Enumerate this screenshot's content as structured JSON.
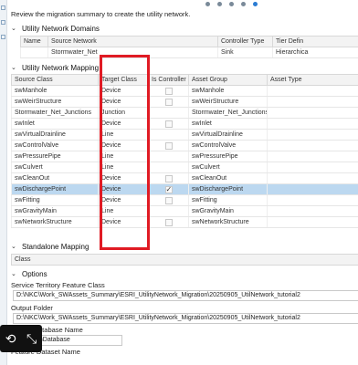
{
  "instruction": "Review the migration summary to create the utility network.",
  "domains": {
    "title": "Utility Network Domains",
    "columns": [
      "Name",
      "Source Network",
      "Controller Type",
      "Tier Defin"
    ],
    "rows": [
      [
        "",
        "Stormwater_Net",
        "Sink",
        "Hierarchica"
      ]
    ]
  },
  "mapping": {
    "title": "Utility Network Mapping",
    "columns": [
      "Source Class",
      "Target Class",
      "Is Controller",
      "Asset Group",
      "Asset Type"
    ],
    "rows": [
      {
        "source": "swManhole",
        "target": "Device",
        "controller": false,
        "group": "swManhole",
        "type": "",
        "selected": false
      },
      {
        "source": "swWeirStructure",
        "target": "Device",
        "controller": false,
        "group": "swWeirStructure",
        "type": "",
        "selected": false
      },
      {
        "source": "Stormwater_Net_Junctions",
        "target": "Junction",
        "controller": false,
        "group": "Stormwater_Net_Junctions",
        "type": "",
        "selected": false
      },
      {
        "source": "swInlet",
        "target": "Device",
        "controller": false,
        "group": "swInlet",
        "type": "",
        "selected": false
      },
      {
        "source": "swVirtualDrainline",
        "target": "Line",
        "controller": false,
        "group": "swVirtualDrainline",
        "type": "",
        "selected": false
      },
      {
        "source": "swControlValve",
        "target": "Device",
        "controller": false,
        "group": "swControlValve",
        "type": "",
        "selected": false
      },
      {
        "source": "swPressurePipe",
        "target": "Line",
        "controller": false,
        "group": "swPressurePipe",
        "type": "",
        "selected": false
      },
      {
        "source": "swCulvert",
        "target": "Line",
        "controller": false,
        "group": "swCulvert",
        "type": "",
        "selected": false
      },
      {
        "source": "swCleanOut",
        "target": "Device",
        "controller": false,
        "group": "swCleanOut",
        "type": "",
        "selected": false
      },
      {
        "source": "swDischargePoint",
        "target": "Device",
        "controller": true,
        "group": "swDischargePoint",
        "type": "",
        "selected": true
      },
      {
        "source": "swFitting",
        "target": "Device",
        "controller": false,
        "group": "swFitting",
        "type": "",
        "selected": false
      },
      {
        "source": "swGravityMain",
        "target": "Line",
        "controller": false,
        "group": "swGravityMain",
        "type": "",
        "selected": false
      },
      {
        "source": "swNetworkStructure",
        "target": "Device",
        "controller": false,
        "group": "swNetworkStructure",
        "type": "",
        "selected": false
      }
    ]
  },
  "standalone": {
    "title": "Standalone Mapping",
    "columns": [
      "Class"
    ]
  },
  "options": {
    "title": "Options",
    "service_territory_label": "Service Territory Feature Class",
    "service_territory_value": "D:\\NKC\\Work_SWAssets_Summary\\ESRI_UtilityNetwork_Migration\\20250905_UtilNetwork_tutorial2",
    "output_folder_label": "Output Folder",
    "output_folder_value": "D:\\NKC\\Work_SWAssets_Summary\\ESRI_UtilityNetwork_Migration\\20250905_UtilNetwork_tutorial2",
    "output_db_label": "Output Database Name",
    "output_db_value": "MigrationDatabase",
    "feature_dataset_label": "Feature Dataset Name"
  },
  "colors": {
    "highlight_box": "#e01b24",
    "selected_row": "#bcd8f0",
    "active_dot": "#2b7cd3"
  },
  "icons": {
    "overlay_left": "rotate-icon",
    "overlay_right": "expand-arrows-icon"
  }
}
